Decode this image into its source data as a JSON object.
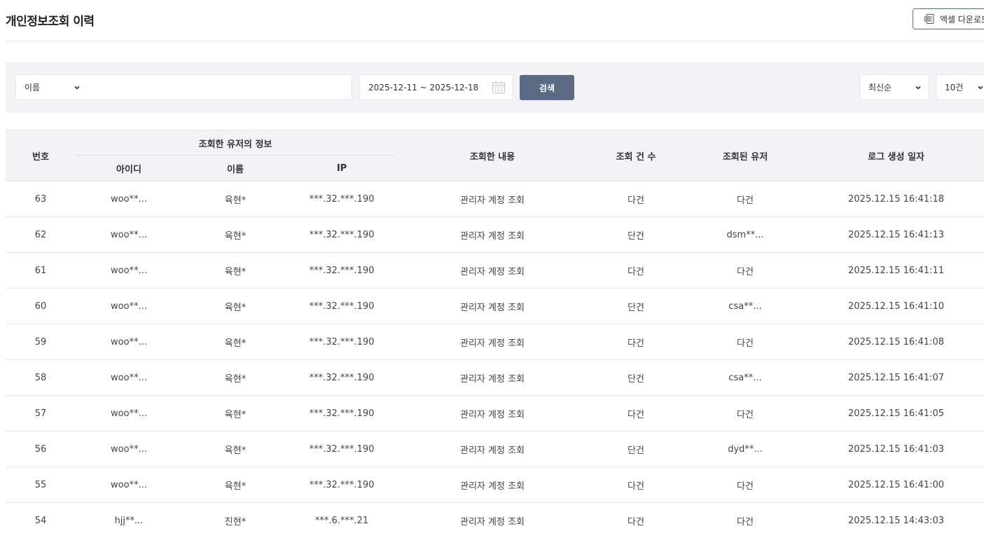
{
  "header": {
    "title": "개인정보조회 이력",
    "excel_button_label": "엑셀 다운로드"
  },
  "filters": {
    "search_type": "이름",
    "search_value": "",
    "date_range": "2025-12-11 ~ 2025-12-18",
    "search_button": "검색",
    "sort": "최신순",
    "page_size": "10건"
  },
  "icons": {
    "excel": "excel-icon",
    "calendar": "calendar-icon",
    "dropdown": "chevron-down-icon"
  },
  "colors": {
    "primary": "#5c6b85",
    "filter_bg": "#f2f3f7",
    "header_bg": "#f2f3f7"
  },
  "table": {
    "headers": {
      "no": "번호",
      "viewer_group": "조회한 유저의 정보",
      "viewer_id": "아이디",
      "viewer_name": "이름",
      "viewer_ip": "IP",
      "content": "조회한 내용",
      "count": "조회 건 수",
      "target": "조회된 유저",
      "created": "로그 생성 일자"
    },
    "rows": [
      {
        "no": "63",
        "id": "woo**...",
        "name": "육현*",
        "ip": "***.32.***.190",
        "content": "관리자 계정 조회",
        "count": "다건",
        "target": "다건",
        "created": "2025.12.15 16:41:18"
      },
      {
        "no": "62",
        "id": "woo**...",
        "name": "육현*",
        "ip": "***.32.***.190",
        "content": "관리자 계정 조회",
        "count": "단건",
        "target": "dsm**...",
        "created": "2025.12.15 16:41:13"
      },
      {
        "no": "61",
        "id": "woo**...",
        "name": "육현*",
        "ip": "***.32.***.190",
        "content": "관리자 계정 조회",
        "count": "다건",
        "target": "다건",
        "created": "2025.12.15 16:41:11"
      },
      {
        "no": "60",
        "id": "woo**...",
        "name": "육현*",
        "ip": "***.32.***.190",
        "content": "관리자 계정 조회",
        "count": "단건",
        "target": "csa**...",
        "created": "2025.12.15 16:41:10"
      },
      {
        "no": "59",
        "id": "woo**...",
        "name": "육현*",
        "ip": "***.32.***.190",
        "content": "관리자 계정 조회",
        "count": "다건",
        "target": "다건",
        "created": "2025.12.15 16:41:08"
      },
      {
        "no": "58",
        "id": "woo**...",
        "name": "육현*",
        "ip": "***.32.***.190",
        "content": "관리자 계정 조회",
        "count": "단건",
        "target": "csa**...",
        "created": "2025.12.15 16:41:07"
      },
      {
        "no": "57",
        "id": "woo**...",
        "name": "육현*",
        "ip": "***.32.***.190",
        "content": "관리자 계정 조회",
        "count": "다건",
        "target": "다건",
        "created": "2025.12.15 16:41:05"
      },
      {
        "no": "56",
        "id": "woo**...",
        "name": "육현*",
        "ip": "***.32.***.190",
        "content": "관리자 계정 조회",
        "count": "단건",
        "target": "dyd**...",
        "created": "2025.12.15 16:41:03"
      },
      {
        "no": "55",
        "id": "woo**...",
        "name": "육현*",
        "ip": "***.32.***.190",
        "content": "관리자 계정 조회",
        "count": "다건",
        "target": "다건",
        "created": "2025.12.15 16:41:00"
      },
      {
        "no": "54",
        "id": "hjj**...",
        "name": "진현*",
        "ip": "***.6.***.21",
        "content": "관리자 계정 조회",
        "count": "다건",
        "target": "다건",
        "created": "2025.12.15 14:43:03"
      }
    ]
  }
}
